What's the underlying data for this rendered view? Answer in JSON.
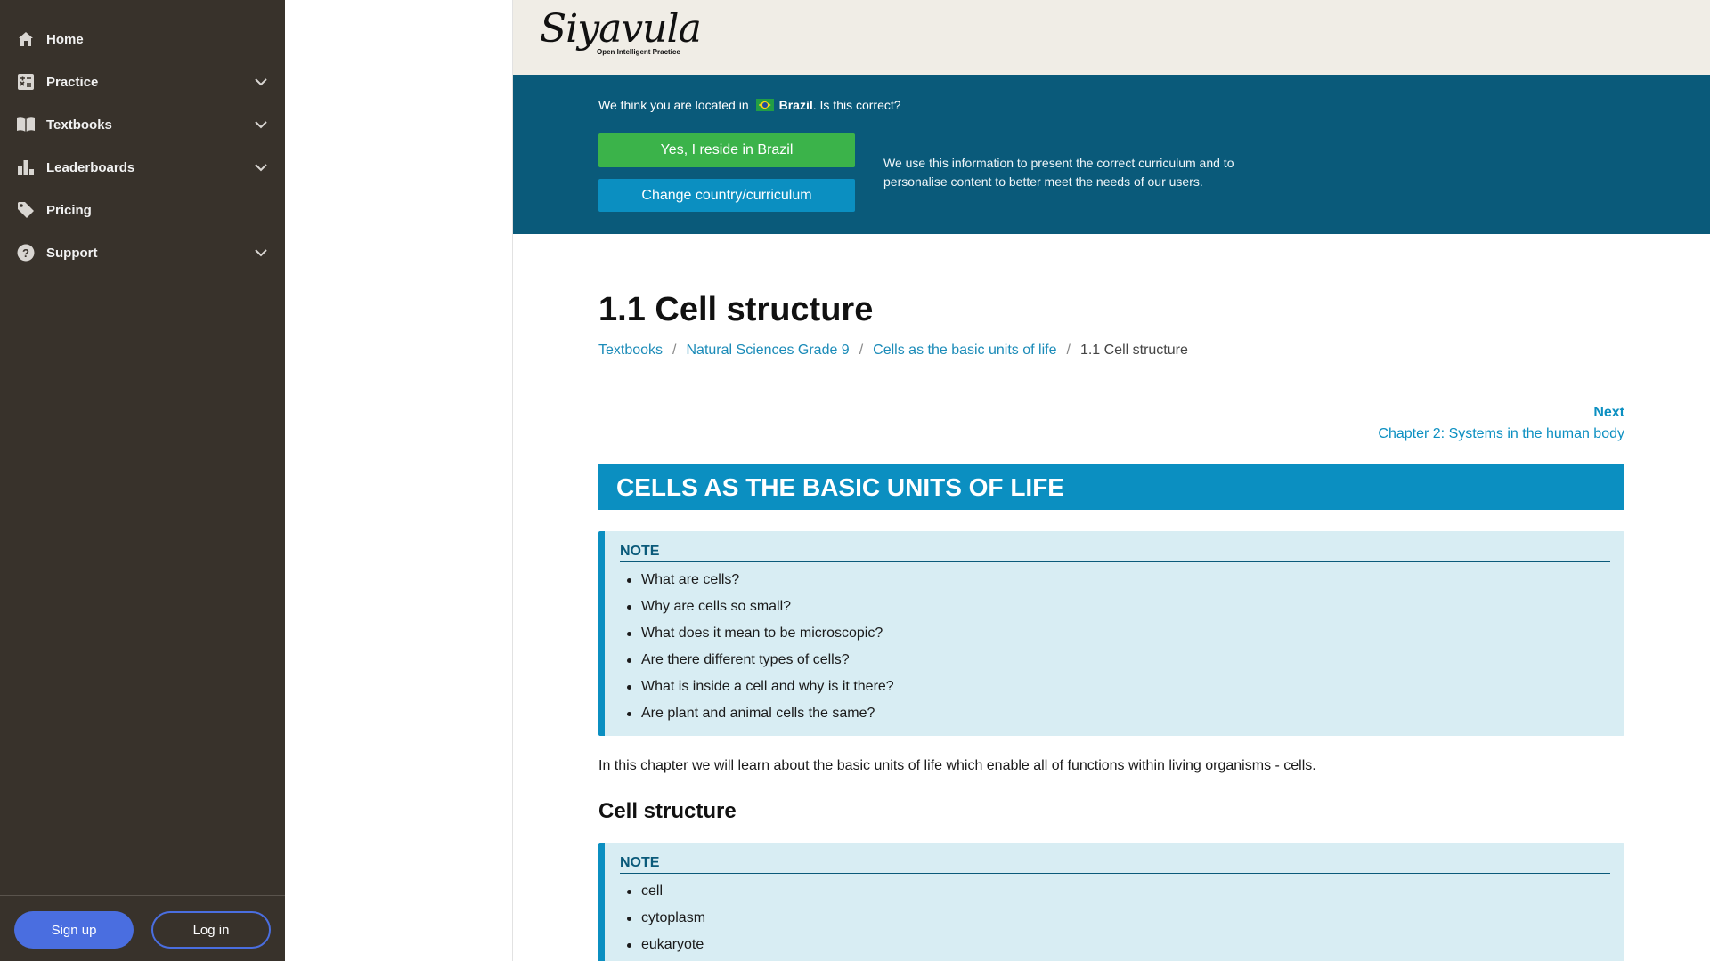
{
  "sidebar": {
    "items": [
      {
        "label": "Home",
        "icon": "home-icon",
        "has_chevron": false
      },
      {
        "label": "Practice",
        "icon": "practice-icon",
        "has_chevron": true
      },
      {
        "label": "Textbooks",
        "icon": "book-icon",
        "has_chevron": true
      },
      {
        "label": "Leaderboards",
        "icon": "bar-chart-icon",
        "has_chevron": true
      },
      {
        "label": "Pricing",
        "icon": "tag-icon",
        "has_chevron": false
      },
      {
        "label": "Support",
        "icon": "help-icon",
        "has_chevron": true
      }
    ],
    "signup_label": "Sign up",
    "login_label": "Log in"
  },
  "header": {
    "logo_text": "Siyavula",
    "logo_tagline": "Open Intelligent Practice"
  },
  "location_banner": {
    "prefix": "We think you are located in",
    "country": "Brazil",
    "suffix": ". Is this correct?",
    "confirm_label": "Yes, I reside in Brazil",
    "change_label": "Change country/curriculum",
    "info": "We use this information to present the correct curriculum and to personalise content to better meet the needs of our users."
  },
  "page": {
    "title": "1.1 Cell structure",
    "breadcrumb": [
      {
        "label": "Textbooks",
        "link": true
      },
      {
        "label": "Natural Sciences Grade 9",
        "link": true
      },
      {
        "label": "Cells as the basic units of life",
        "link": true
      },
      {
        "label": "1.1 Cell structure",
        "link": false
      }
    ],
    "next_label": "Next",
    "next_chapter": "Chapter 2: Systems in the human body",
    "chapter_heading": "CELLS AS THE BASIC UNITS OF LIFE",
    "note1": {
      "title": "NOTE",
      "items": [
        "What are cells?",
        "Why are cells so small?",
        "What does it mean to be microscopic?",
        "Are there different types of cells?",
        "What is inside a cell and why is it there?",
        "Are plant and animal cells the same?"
      ]
    },
    "intro": "In this chapter we will learn about the basic units of life which enable all of functions within living organisms - cells.",
    "section_title": "Cell structure",
    "note2": {
      "title": "NOTE",
      "items": [
        "cell",
        "cytoplasm",
        "eukaryote"
      ]
    }
  },
  "colors": {
    "sidebar_bg": "#38322b",
    "banner_bg": "#0a5a7a",
    "accent": "#0b8fc1",
    "confirm_green": "#3bb34a",
    "note_bg": "#d8edf3"
  }
}
